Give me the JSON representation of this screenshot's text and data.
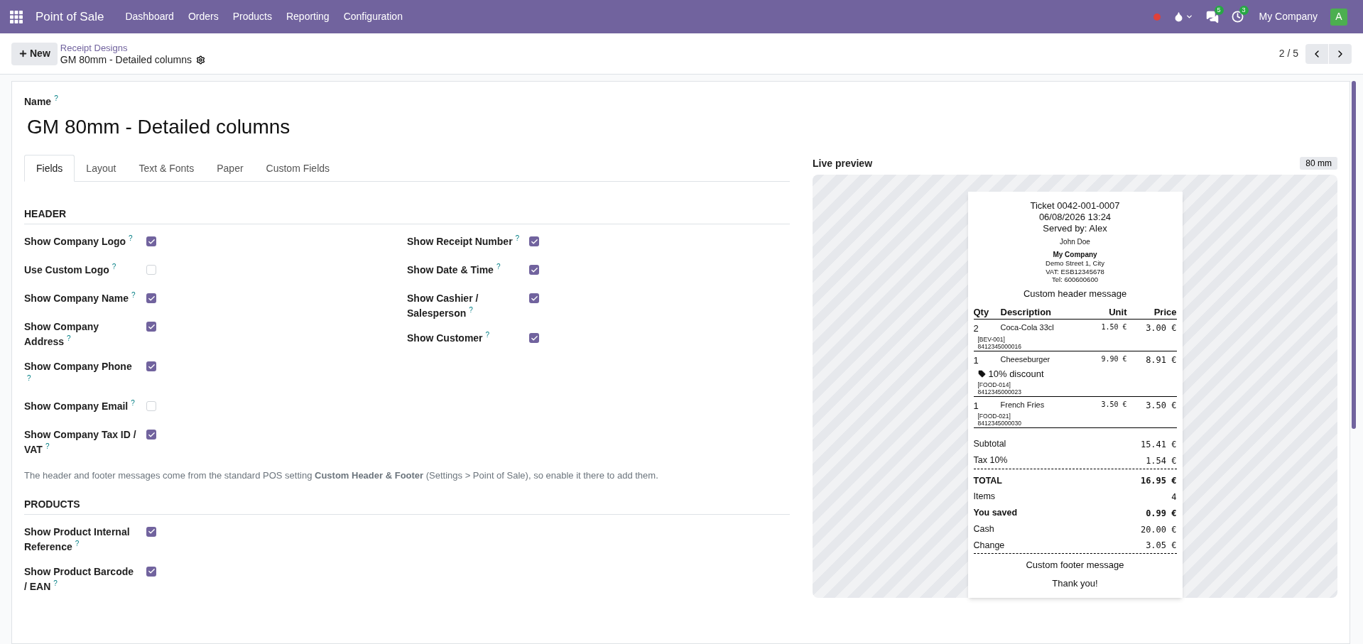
{
  "navbar": {
    "brand": "Point of Sale",
    "menus": [
      "Dashboard",
      "Orders",
      "Products",
      "Reporting",
      "Configuration"
    ],
    "messages_badge": "5",
    "activities_badge": "3",
    "company": "My Company",
    "avatar": "A"
  },
  "control_panel": {
    "new_button": "New",
    "breadcrumb": "Receipt Designs",
    "record_title": "GM 80mm - Detailed columns",
    "pager": "2 / 5"
  },
  "form": {
    "name_label": "Name",
    "name_help": "?",
    "name_value": "GM 80mm - Detailed columns",
    "tabs": [
      {
        "label": "Fields",
        "selected": true
      },
      {
        "label": "Layout",
        "selected": false
      },
      {
        "label": "Text & Fonts",
        "selected": false
      },
      {
        "label": "Paper",
        "selected": false
      },
      {
        "label": "Custom Fields",
        "selected": false
      }
    ],
    "sections": [
      {
        "title": "HEADER",
        "columns": [
          [
            {
              "label": "Show Company Logo",
              "help": "?",
              "checked": true
            },
            {
              "label": "Use Custom Logo",
              "help": "?",
              "checked": false
            },
            {
              "label": "Show Company Name",
              "help": "?",
              "checked": true
            },
            {
              "label": "Show Company Address",
              "help": "?",
              "checked": true
            },
            {
              "label": "Show Company Phone",
              "help": "?",
              "checked": true
            },
            {
              "label": "Show Company Email",
              "help": "?",
              "checked": false
            },
            {
              "label": "Show Company Tax ID / VAT",
              "help": "?",
              "checked": true
            }
          ],
          [
            {
              "label": "Show Receipt Number",
              "help": "?",
              "checked": true
            },
            {
              "label": "Show Date & Time",
              "help": "?",
              "checked": true
            },
            {
              "label": "Show Cashier / Salesperson",
              "help": "?",
              "checked": true
            },
            {
              "label": "Show Customer",
              "help": "?",
              "checked": true
            }
          ]
        ],
        "note": "The header and footer messages come from the standard POS setting **Custom Header & Footer** (Settings > Point of Sale), so enable it there to add them."
      },
      {
        "title": "PRODUCTS",
        "columns": [
          [
            {
              "label": "Show Product Internal Reference",
              "help": "?",
              "checked": true
            },
            {
              "label": "Show Product Barcode / EAN",
              "help": "?",
              "checked": true
            }
          ]
        ]
      }
    ]
  },
  "preview": {
    "title": "Live preview",
    "paper_badge": "80 mm",
    "receipt": {
      "header_lines": [
        {
          "text": "Ticket 0042-001-0007",
          "kind": "large"
        },
        {
          "text": "06/08/2026 13:24",
          "kind": "large"
        },
        {
          "text": "Served by: Alex",
          "kind": "large"
        },
        {
          "text": "John Doe",
          "kind": "customer"
        },
        {
          "text": "My Company",
          "kind": "company"
        },
        {
          "text": "Demo Street 1, City",
          "kind": "detail"
        },
        {
          "text": "VAT: ESB12345678",
          "kind": "detail"
        },
        {
          "text": "Tel: 600600600",
          "kind": "detail"
        },
        {
          "text": "Custom header message",
          "kind": "message"
        }
      ],
      "columns": [
        "Qty",
        "Description",
        "Unit",
        "Price"
      ],
      "lines": [
        {
          "qty": "2",
          "name": "Coca-Cola 33cl",
          "unit": "1.50 €",
          "price": "3.00 €",
          "reference": "[BEV-001]",
          "barcode": "8412345000016"
        },
        {
          "qty": "1",
          "name": "Cheeseburger",
          "unit": "9.90 €",
          "price": "8.91 €",
          "discount": "10% discount",
          "reference": "[FOOD-014]",
          "barcode": "8412345000023"
        },
        {
          "qty": "1",
          "name": "French Fries",
          "unit": "3.50 €",
          "price": "3.50 €",
          "reference": "[FOOD-021]",
          "barcode": "8412345000030"
        }
      ],
      "totals": [
        {
          "label": "Subtotal",
          "value": "15.41 €",
          "bold": false,
          "rule_after": false
        },
        {
          "label": "Tax 10%",
          "value": "1.54 €",
          "bold": false,
          "rule_after": true
        },
        {
          "label": "TOTAL",
          "value": "16.95 €",
          "bold": true,
          "rule_after": false
        },
        {
          "label": "Items",
          "value": "4",
          "bold": false,
          "rule_after": false
        },
        {
          "label": "You saved",
          "value": "0.99 €",
          "bold": true,
          "rule_after": false
        },
        {
          "label": "Cash",
          "value": "20.00 €",
          "bold": false,
          "rule_after": false
        },
        {
          "label": "Change",
          "value": "3.05 €",
          "bold": false,
          "rule_after": true
        }
      ],
      "footer_lines": [
        "Custom footer message",
        "Thank you!"
      ]
    }
  }
}
